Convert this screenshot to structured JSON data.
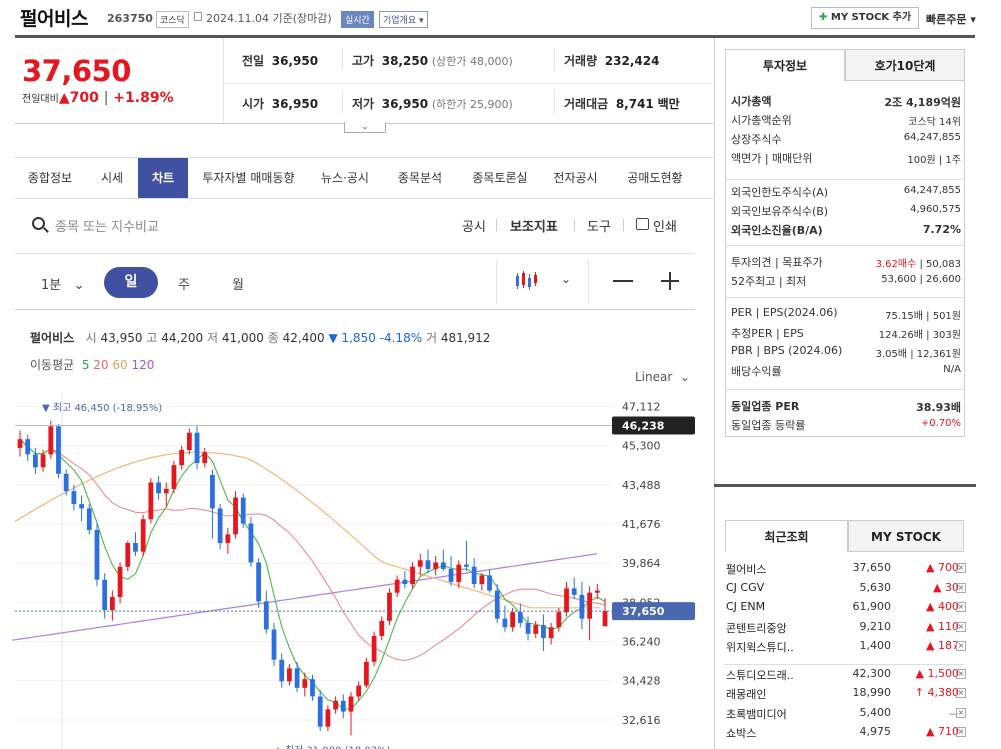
{
  "header": {
    "stock_name": "펄어비스",
    "stock_code": "263750",
    "market_tag": "코스닥",
    "date_text": "2024.11.04 기준(장마감)",
    "realtime_tag": "실시간",
    "company_tag": "기업개요",
    "my_stock_add": "MY STOCK 추가",
    "quick_order": "빠른주문"
  },
  "price": {
    "current": "37,650",
    "change_label": "전일대비",
    "change_arrow": "▲",
    "change": "700",
    "change_pct": "+1.89%"
  },
  "summary": {
    "prev_label": "전일",
    "prev": "36,950",
    "high_label": "고가",
    "high": "38,250",
    "upper_limit": "(상한가 48,000)",
    "volume_label": "거래량",
    "volume": "232,424",
    "open_label": "시가",
    "open": "36,950",
    "low_label": "저가",
    "low": "36,950",
    "lower_limit": "(하한가 25,900)",
    "amount_label": "거래대금",
    "amount": "8,741",
    "amount_unit": "백만"
  },
  "tabs": [
    "종합정보",
    "시세",
    "차트",
    "투자자별 매매동향",
    "뉴스·공시",
    "종목분석",
    "종목토론실",
    "전자공시",
    "공매도현황"
  ],
  "search": {
    "placeholder": "종목 또는 지수비교"
  },
  "tools": {
    "disclosure": "공시",
    "indicator": "보조지표",
    "draw": "도구",
    "print": "인쇄"
  },
  "periods": {
    "minute": "1분",
    "day": "일",
    "week": "주",
    "month": "월"
  },
  "chart_info": {
    "name": "펄어비스",
    "open_label": "시",
    "open": "43,950",
    "high_label": "고",
    "high": "44,200",
    "low_label": "저",
    "low": "41,000",
    "close_label": "종",
    "close": "42,400",
    "change": "▼ 1,850 -4.18%",
    "vol_label": "거",
    "vol": "481,912",
    "ma_label": "이동평균",
    "ma": [
      "5",
      "20",
      "60",
      "120"
    ],
    "scale": "Linear"
  },
  "chart_data": {
    "type": "candlestick",
    "y_ticks": [
      "47,112",
      "45,300",
      "43,488",
      "41,676",
      "39,864",
      "38,052",
      "36,240",
      "34,428",
      "32,616"
    ],
    "ylim": [
      31500,
      47600
    ],
    "max_label": "▼ 최고 46,450 (-18.95%)",
    "min_label": "▲ 최저 31,900 (18.03%)",
    "hover_price": "46,238",
    "current_price": "37,650",
    "candles": [
      [
        45200,
        46000,
        44800,
        45600
      ],
      [
        45600,
        45800,
        44600,
        44900
      ],
      [
        44900,
        45200,
        44000,
        44300
      ],
      [
        44300,
        45100,
        44100,
        44900
      ],
      [
        44900,
        46450,
        44700,
        46200
      ],
      [
        46200,
        46300,
        43800,
        44000
      ],
      [
        44000,
        44200,
        43000,
        43200
      ],
      [
        43200,
        43500,
        42300,
        42600
      ],
      [
        42600,
        43000,
        41800,
        42400
      ],
      [
        42400,
        42600,
        41200,
        41400
      ],
      [
        41400,
        41700,
        38800,
        39100
      ],
      [
        39100,
        39400,
        37300,
        37700
      ],
      [
        37700,
        38600,
        37200,
        38300
      ],
      [
        38300,
        39900,
        38000,
        39700
      ],
      [
        39700,
        40900,
        39500,
        40800
      ],
      [
        40800,
        41300,
        40200,
        40400
      ],
      [
        40400,
        42100,
        40200,
        41900
      ],
      [
        41900,
        43800,
        41700,
        43600
      ],
      [
        43600,
        43900,
        42800,
        43100
      ],
      [
        43100,
        43600,
        42500,
        43300
      ],
      [
        43300,
        44600,
        43100,
        44400
      ],
      [
        44400,
        45300,
        44200,
        45100
      ],
      [
        45100,
        46100,
        44900,
        45900
      ],
      [
        45900,
        46200,
        44200,
        44500
      ],
      [
        44500,
        45200,
        44300,
        45000
      ],
      [
        43950,
        44200,
        41000,
        42400
      ],
      [
        42400,
        42600,
        40500,
        40800
      ],
      [
        40800,
        41500,
        40300,
        41200
      ],
      [
        41200,
        43200,
        41000,
        42900
      ],
      [
        42900,
        43100,
        41500,
        41700
      ],
      [
        41700,
        42000,
        39700,
        39900
      ],
      [
        39900,
        40100,
        37800,
        38100
      ],
      [
        38100,
        38600,
        36600,
        36800
      ],
      [
        36800,
        37100,
        35100,
        35400
      ],
      [
        35400,
        35700,
        34100,
        34400
      ],
      [
        34400,
        35200,
        34200,
        35000
      ],
      [
        35000,
        35300,
        33900,
        34100
      ],
      [
        34100,
        34800,
        33700,
        34500
      ],
      [
        34500,
        34700,
        33500,
        33700
      ],
      [
        33700,
        34000,
        32100,
        32300
      ],
      [
        32300,
        33300,
        32100,
        33100
      ],
      [
        33100,
        33700,
        32900,
        33500
      ],
      [
        33500,
        33800,
        32700,
        33000
      ],
      [
        33000,
        33900,
        31900,
        33700
      ],
      [
        33700,
        34400,
        33500,
        34200
      ],
      [
        34200,
        35500,
        34100,
        35300
      ],
      [
        35300,
        36700,
        35100,
        36500
      ],
      [
        36500,
        37400,
        36300,
        37200
      ],
      [
        37200,
        38700,
        37000,
        38500
      ],
      [
        38500,
        39300,
        38300,
        39100
      ],
      [
        39100,
        39500,
        38700,
        38900
      ],
      [
        38900,
        39900,
        38700,
        39700
      ],
      [
        39700,
        40300,
        39300,
        40000
      ],
      [
        40000,
        40500,
        39400,
        39600
      ],
      [
        39600,
        40200,
        39300,
        39900
      ],
      [
        39900,
        40500,
        39500,
        39600
      ],
      [
        39600,
        40200,
        38800,
        39000
      ],
      [
        39000,
        40000,
        38700,
        39800
      ],
      [
        39800,
        40900,
        39500,
        39700
      ],
      [
        39700,
        40100,
        38700,
        38900
      ],
      [
        38900,
        39400,
        38600,
        39300
      ],
      [
        39300,
        39600,
        38500,
        38600
      ],
      [
        38600,
        38900,
        37100,
        37300
      ],
      [
        37300,
        37900,
        36700,
        36900
      ],
      [
        36900,
        37800,
        36700,
        37600
      ],
      [
        37600,
        38000,
        36900,
        37100
      ],
      [
        37100,
        37400,
        36300,
        36600
      ],
      [
        36600,
        37200,
        36400,
        37000
      ],
      [
        37000,
        37500,
        35800,
        36400
      ],
      [
        36400,
        37100,
        36100,
        36900
      ],
      [
        36900,
        37800,
        36700,
        37600
      ],
      [
        37600,
        39000,
        37400,
        38700
      ],
      [
        38700,
        39200,
        38200,
        38400
      ],
      [
        38400,
        39000,
        36800,
        37300
      ],
      [
        37300,
        38800,
        36300,
        38500
      ],
      [
        38500,
        38900,
        38200,
        38600
      ],
      [
        36950,
        38250,
        36950,
        37650
      ]
    ]
  },
  "right": {
    "tab_info": "투자정보",
    "tab_order": "호가10단계",
    "rows1": [
      {
        "l": "시가총액",
        "r": "2조 4,189억원",
        "bold": true
      },
      {
        "l": "시가총액순위",
        "r": "코스닥 14위"
      },
      {
        "l": "상장주식수",
        "r": "64,247,855"
      },
      {
        "l": "액면가 | 매매단위",
        "r": "100원 | 1주"
      }
    ],
    "rows2": [
      {
        "l": "외국인한도주식수(A)",
        "r": "64,247,855"
      },
      {
        "l": "외국인보유주식수(B)",
        "r": "4,960,575"
      },
      {
        "l": "외국인소진율(B/A)",
        "r": "7.72%",
        "bold": true
      }
    ],
    "rows3": [
      {
        "l": "투자의견 | 목표주가",
        "r1": "3.62매수",
        "r2": " | 50,083"
      },
      {
        "l": "52주최고 | 최저",
        "r": "53,600 | 26,600"
      }
    ],
    "rows4": [
      {
        "l": "PER | EPS(2024.06)",
        "r": "75.15배 | 501원"
      },
      {
        "l": "추정PER | EPS",
        "r": "124.26배 | 303원"
      },
      {
        "l": "PBR | BPS (2024.06)",
        "r": "3.05배 | 12,361원"
      },
      {
        "l": "배당수익률",
        "r": "N/A"
      }
    ],
    "rows5": [
      {
        "l": "동일업종 PER",
        "r": "38.93배",
        "bold": true
      },
      {
        "l": "동일업종 등락률",
        "r": "+0.70%",
        "red": true
      }
    ],
    "recent_tab": "최근조회",
    "mystock_tab": "MY STOCK",
    "recent": [
      {
        "name": "펄어비스",
        "price": "37,650",
        "chg": "▲ 700"
      },
      {
        "name": "CJ CGV",
        "price": "5,630",
        "chg": "▲ 30"
      },
      {
        "name": "CJ ENM",
        "price": "61,900",
        "chg": "▲ 400"
      },
      {
        "name": "콘텐트리중앙",
        "price": "9,210",
        "chg": "▲ 110"
      },
      {
        "name": "위지윅스튜디..",
        "price": "1,400",
        "chg": "▲ 187"
      },
      {
        "name": "스튜디오드래..",
        "price": "42,300",
        "chg": "▲ 1,500"
      },
      {
        "name": "래몽래인",
        "price": "18,990",
        "chg": "↑ 4,380"
      },
      {
        "name": "초록뱀미디어",
        "price": "5,400",
        "chg": "－"
      },
      {
        "name": "쇼박스",
        "price": "4,975",
        "chg": "▲ 710"
      }
    ]
  }
}
